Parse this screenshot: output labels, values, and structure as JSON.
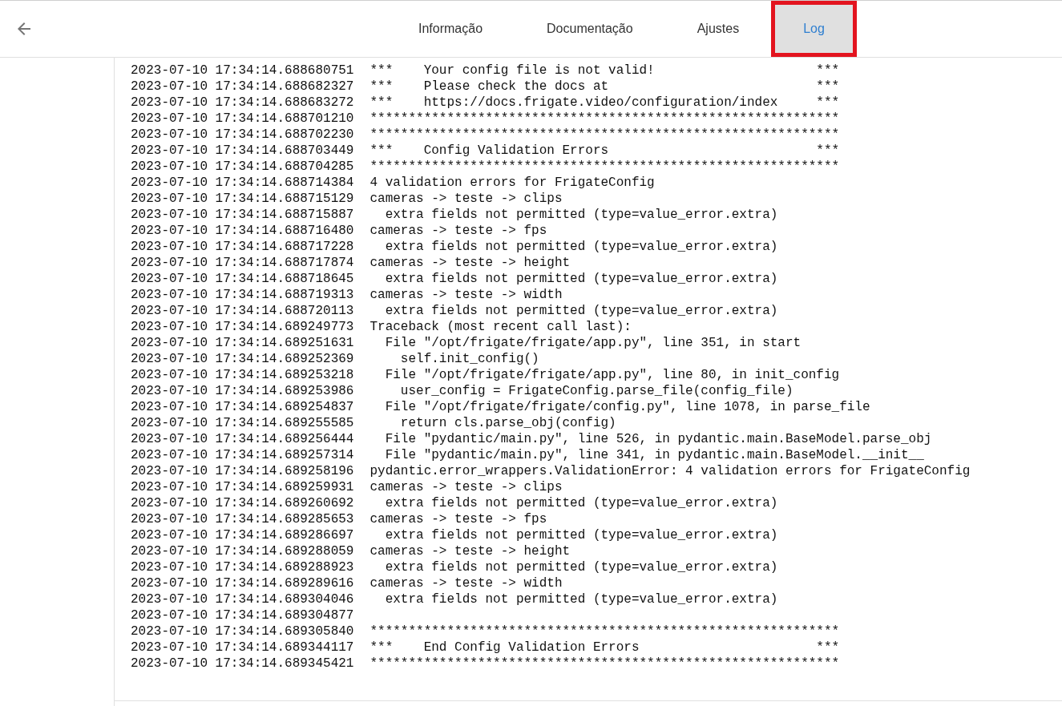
{
  "tabs": [
    {
      "label": "Informação",
      "selected": false
    },
    {
      "label": "Documentação",
      "selected": false
    },
    {
      "label": "Ajustes",
      "selected": false
    },
    {
      "label": "Log",
      "selected": true
    }
  ],
  "log": [
    {
      "time": "2023-07-10 17:34:14.688680751",
      "message": "***    Your config file is not valid!                     ***"
    },
    {
      "time": "2023-07-10 17:34:14.688682327",
      "message": "***    Please check the docs at                           ***"
    },
    {
      "time": "2023-07-10 17:34:14.688683272",
      "message": "***    https://docs.frigate.video/configuration/index     ***"
    },
    {
      "time": "2023-07-10 17:34:14.688701210",
      "message": "*************************************************************"
    },
    {
      "time": "2023-07-10 17:34:14.688702230",
      "message": "*************************************************************"
    },
    {
      "time": "2023-07-10 17:34:14.688703449",
      "message": "***    Config Validation Errors                           ***"
    },
    {
      "time": "2023-07-10 17:34:14.688704285",
      "message": "*************************************************************"
    },
    {
      "time": "2023-07-10 17:34:14.688714384",
      "message": "4 validation errors for FrigateConfig"
    },
    {
      "time": "2023-07-10 17:34:14.688715129",
      "message": "cameras -> teste -> clips"
    },
    {
      "time": "2023-07-10 17:34:14.688715887",
      "message": "  extra fields not permitted (type=value_error.extra)"
    },
    {
      "time": "2023-07-10 17:34:14.688716480",
      "message": "cameras -> teste -> fps"
    },
    {
      "time": "2023-07-10 17:34:14.688717228",
      "message": "  extra fields not permitted (type=value_error.extra)"
    },
    {
      "time": "2023-07-10 17:34:14.688717874",
      "message": "cameras -> teste -> height"
    },
    {
      "time": "2023-07-10 17:34:14.688718645",
      "message": "  extra fields not permitted (type=value_error.extra)"
    },
    {
      "time": "2023-07-10 17:34:14.688719313",
      "message": "cameras -> teste -> width"
    },
    {
      "time": "2023-07-10 17:34:14.688720113",
      "message": "  extra fields not permitted (type=value_error.extra)"
    },
    {
      "time": "2023-07-10 17:34:14.689249773",
      "message": "Traceback (most recent call last):"
    },
    {
      "time": "2023-07-10 17:34:14.689251631",
      "message": "  File \"/opt/frigate/frigate/app.py\", line 351, in start"
    },
    {
      "time": "2023-07-10 17:34:14.689252369",
      "message": "    self.init_config()"
    },
    {
      "time": "2023-07-10 17:34:14.689253218",
      "message": "  File \"/opt/frigate/frigate/app.py\", line 80, in init_config"
    },
    {
      "time": "2023-07-10 17:34:14.689253986",
      "message": "    user_config = FrigateConfig.parse_file(config_file)"
    },
    {
      "time": "2023-07-10 17:34:14.689254837",
      "message": "  File \"/opt/frigate/frigate/config.py\", line 1078, in parse_file"
    },
    {
      "time": "2023-07-10 17:34:14.689255585",
      "message": "    return cls.parse_obj(config)"
    },
    {
      "time": "2023-07-10 17:34:14.689256444",
      "message": "  File \"pydantic/main.py\", line 526, in pydantic.main.BaseModel.parse_obj"
    },
    {
      "time": "2023-07-10 17:34:14.689257314",
      "message": "  File \"pydantic/main.py\", line 341, in pydantic.main.BaseModel.__init__"
    },
    {
      "time": "2023-07-10 17:34:14.689258196",
      "message": "pydantic.error_wrappers.ValidationError: 4 validation errors for FrigateConfig"
    },
    {
      "time": "2023-07-10 17:34:14.689259931",
      "message": "cameras -> teste -> clips"
    },
    {
      "time": "2023-07-10 17:34:14.689260692",
      "message": "  extra fields not permitted (type=value_error.extra)"
    },
    {
      "time": "2023-07-10 17:34:14.689285653",
      "message": "cameras -> teste -> fps"
    },
    {
      "time": "2023-07-10 17:34:14.689286697",
      "message": "  extra fields not permitted (type=value_error.extra)"
    },
    {
      "time": "2023-07-10 17:34:14.689288059",
      "message": "cameras -> teste -> height"
    },
    {
      "time": "2023-07-10 17:34:14.689288923",
      "message": "  extra fields not permitted (type=value_error.extra)"
    },
    {
      "time": "2023-07-10 17:34:14.689289616",
      "message": "cameras -> teste -> width"
    },
    {
      "time": "2023-07-10 17:34:14.689304046",
      "message": "  extra fields not permitted (type=value_error.extra)"
    },
    {
      "time": "2023-07-10 17:34:14.689304877"
    },
    {
      "time": "2023-07-10 17:34:14.689305840",
      "message": "*************************************************************"
    },
    {
      "time": "2023-07-10 17:34:14.689344117",
      "message": "***    End Config Validation Errors                       ***"
    },
    {
      "time": "2023-07-10 17:34:14.689345421",
      "message": "*************************************************************"
    }
  ]
}
